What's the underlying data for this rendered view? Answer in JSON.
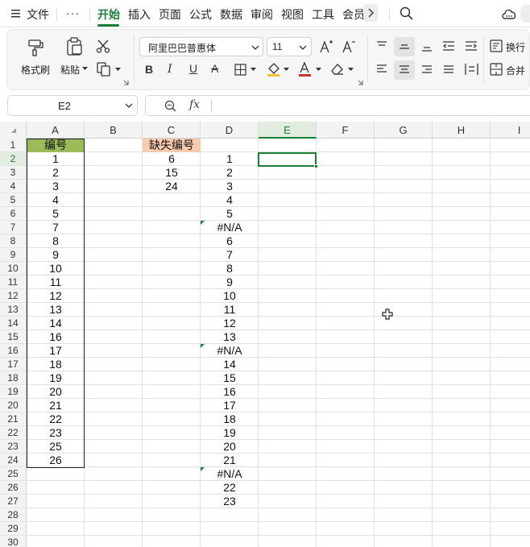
{
  "menu": {
    "hamburger_label": "文件",
    "more": "···",
    "tabs": [
      "开始",
      "插入",
      "页面",
      "公式",
      "数据",
      "审阅",
      "视图",
      "工具",
      "会员"
    ],
    "active_tab": "开始"
  },
  "ribbon": {
    "format_painter": "格式刷",
    "paste": "粘贴",
    "font_name": "阿里巴巴普惠体",
    "font_size": "11",
    "wrap": "换行",
    "merge": "合并"
  },
  "formula_bar": {
    "cell_ref": "E2",
    "fx": "fx",
    "formula": ""
  },
  "sheet": {
    "columns": [
      "A",
      "B",
      "C",
      "D",
      "E",
      "F",
      "G",
      "H",
      "I"
    ],
    "selected_column": "E",
    "selected_row": "2",
    "rows": [
      "1",
      "2",
      "3",
      "4",
      "5",
      "6",
      "7",
      "8",
      "9",
      "10",
      "11",
      "12",
      "13",
      "14",
      "15",
      "16",
      "17",
      "18",
      "19",
      "20",
      "21",
      "22",
      "23",
      "24",
      "25",
      "26",
      "27",
      "28",
      "29",
      "30"
    ],
    "header_a": "编号",
    "header_c": "缺失编号",
    "col_a": [
      "1",
      "2",
      "3",
      "4",
      "5",
      "7",
      "8",
      "9",
      "10",
      "11",
      "12",
      "13",
      "14",
      "16",
      "17",
      "18",
      "19",
      "20",
      "21",
      "22",
      "23",
      "25",
      "26"
    ],
    "col_c": [
      "6",
      "15",
      "24"
    ],
    "col_d": [
      "1",
      "2",
      "3",
      "4",
      "5",
      "#N/A",
      "6",
      "7",
      "8",
      "9",
      "10",
      "11",
      "12",
      "13",
      "#N/A",
      "14",
      "15",
      "16",
      "17",
      "18",
      "19",
      "20",
      "21",
      "#N/A",
      "22",
      "23"
    ],
    "colors": {
      "header_a_fill": "#9bbb59",
      "header_c_fill": "#f8cbad",
      "accent": "#1a7f37"
    }
  }
}
